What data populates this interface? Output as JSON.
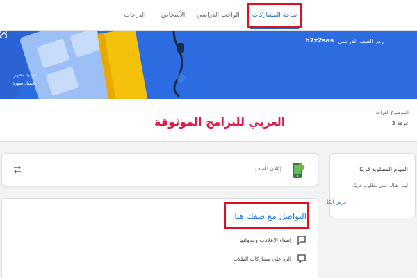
{
  "tabs": {
    "stream": "ساحة المشاركات",
    "classwork": "الواجب الدراسي",
    "people": "الأشخاص",
    "grades": "الدرجات"
  },
  "banner": {
    "class_code_label": "رمز الصف الدراسي",
    "class_code_value": "h7z2sas",
    "select_theme": "تحديد مظهر",
    "upload_photo": "تحميل صورة",
    "bg_color": "#2c6be0"
  },
  "info": {
    "topic": "الموضوع الذرات",
    "room": "غرفة 3",
    "watermark": "العربي للبرامج الموثوقة"
  },
  "announce": {
    "placeholder": "إعلان للصف"
  },
  "upcoming": {
    "title": "المهام المطلوبة قريبًا",
    "empty": "ليس هناك عمل مطلوب قريبًا.",
    "view_all": "عرض الكل"
  },
  "communicate": {
    "title": "التواصل مع صفك هنا",
    "item1": "إنشاء الإعلانات وجدولتها",
    "item2": "الرد على مشاركات الطلاب"
  },
  "colors": {
    "accent": "#1967d2",
    "highlight": "#e01020"
  }
}
